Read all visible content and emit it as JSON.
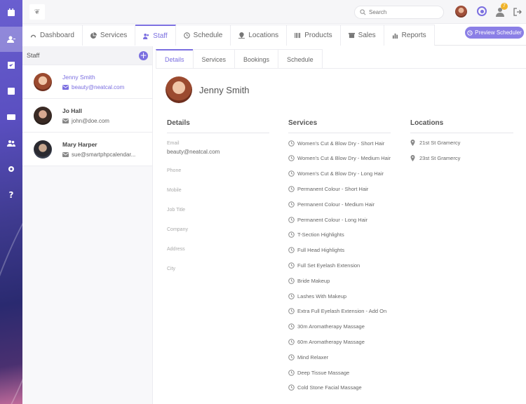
{
  "topbar": {
    "search_placeholder": "Search",
    "notification_count": "7"
  },
  "main_tabs": [
    {
      "label": "Dashboard",
      "icon": "dashboard-icon"
    },
    {
      "label": "Services",
      "icon": "pie-icon"
    },
    {
      "label": "Staff",
      "icon": "users-icon",
      "active": true
    },
    {
      "label": "Schedule",
      "icon": "clock-icon"
    },
    {
      "label": "Locations",
      "icon": "pin-icon"
    },
    {
      "label": "Products",
      "icon": "barcode-icon"
    },
    {
      "label": "Sales",
      "icon": "shop-icon"
    },
    {
      "label": "Reports",
      "icon": "bar-chart-icon"
    }
  ],
  "preview_button": "Preview Scheduler",
  "staff_panel": {
    "title": "Staff",
    "items": [
      {
        "name": "Jenny Smith",
        "email": "beauty@neatcal.com"
      },
      {
        "name": "Jo Hall",
        "email": "john@doe.com"
      },
      {
        "name": "Mary Harper",
        "email": "sue@smartphpcalendar..."
      }
    ]
  },
  "detail_tabs": [
    "Details",
    "Services",
    "Bookings",
    "Schedule"
  ],
  "profile": {
    "name": "Jenny Smith"
  },
  "details": {
    "title": "Details",
    "fields": [
      {
        "label": "Email",
        "value": "beauty@neatcal.com"
      },
      {
        "label": "Phone",
        "value": ""
      },
      {
        "label": "Mobile",
        "value": ""
      },
      {
        "label": "Job Title",
        "value": ""
      },
      {
        "label": "Company",
        "value": ""
      },
      {
        "label": "Address",
        "value": ""
      },
      {
        "label": "City",
        "value": ""
      }
    ]
  },
  "services": {
    "title": "Services",
    "items": [
      "Women's Cut & Blow Dry - Short Hair",
      "Women's Cut & Blow Dry - Medium Hair",
      "Women's Cut & Blow Dry - Long Hair",
      "Permanent Colour - Short Hair",
      "Permanent Colour - Medium Hair",
      "Permanent Colour - Long Hair",
      "T-Section Highlights",
      "Full Head Highlights",
      "Full Set Eyelash Extension",
      "Bride Makeup",
      "Lashes With Makeup",
      "Extra Full Eyelash Extension - Add On",
      "30m Aromatherapy Massage",
      "60m Aromatherapy Massage",
      "Mind Relaxer",
      "Deep Tissue Massage",
      "Cold Stone Facial Massage"
    ]
  },
  "locations": {
    "title": "Locations",
    "items": [
      "21st St Gramercy",
      "23st St Gramercy"
    ]
  },
  "colors": {
    "accent": "#7b6fe0",
    "badge": "#f0b42a"
  }
}
